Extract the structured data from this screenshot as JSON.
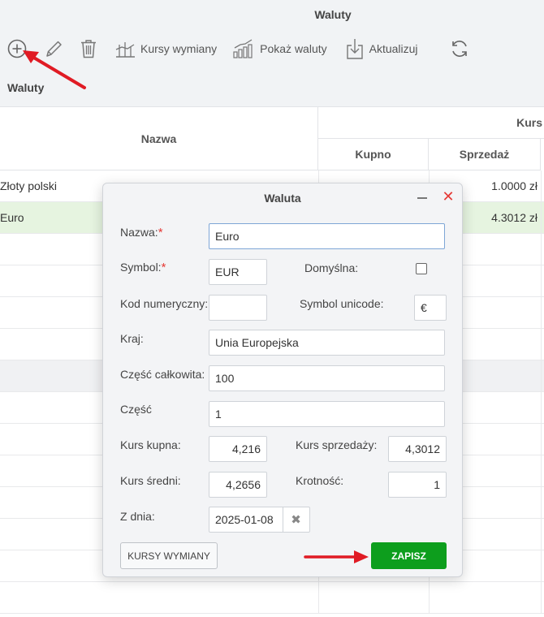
{
  "app": {
    "title": "Waluty",
    "section_title": "Waluty"
  },
  "toolbar": {
    "add_icon": "plus-circle-icon",
    "edit_icon": "pencil-icon",
    "delete_icon": "trash-icon",
    "exchange_label": "Kursy wymiany",
    "show_label": "Pokaż waluty",
    "update_label": "Aktualizuj",
    "refresh_icon": "refresh-icon"
  },
  "grid": {
    "col_nazwa": "Nazwa",
    "col_kurs": "Kurs",
    "col_kupno": "Kupno",
    "col_sprzedaz": "Sprzedaż",
    "rows": [
      {
        "nazwa": "Złoty polski",
        "sprzedaz": "1.0000 zł"
      },
      {
        "nazwa": "Euro",
        "sprzedaz": "4.3012 zł"
      }
    ]
  },
  "dialog": {
    "title": "Waluta",
    "labels": {
      "nazwa": "Nazwa:",
      "symbol": "Symbol:",
      "domyslna": "Domyślna:",
      "kod": "Kod numeryczny:",
      "unicode": "Symbol unicode:",
      "kraj": "Kraj:",
      "czesc_calkowita": "Część całkowita:",
      "czesc": "Część",
      "kurs_kupna": "Kurs kupna:",
      "kurs_sprzedazy": "Kurs sprzedaży:",
      "kurs_sredni": "Kurs średni:",
      "krotnosc": "Krotność:",
      "z_dnia": "Z dnia:"
    },
    "required_mark": "*",
    "values": {
      "nazwa": "Euro",
      "symbol": "EUR",
      "kod": "",
      "unicode": "€",
      "kraj": "Unia Europejska",
      "czesc_calkowita": "100",
      "czesc": "1",
      "kurs_kupna": "4,216",
      "kurs_sprzedazy": "4,3012",
      "kurs_sredni": "4,2656",
      "krotnosc": "1",
      "z_dnia": "2025-01-08"
    },
    "domyslna_checked": false,
    "clear_glyph": "✖",
    "close_glyph": "✕",
    "btn_kursy": "KURSY WYMIANY",
    "btn_zapisz": "ZAPISZ"
  },
  "colors": {
    "accent_green": "#0d9e1d",
    "annotation_red": "#e01b24",
    "selected_row": "#e6f4e0"
  }
}
